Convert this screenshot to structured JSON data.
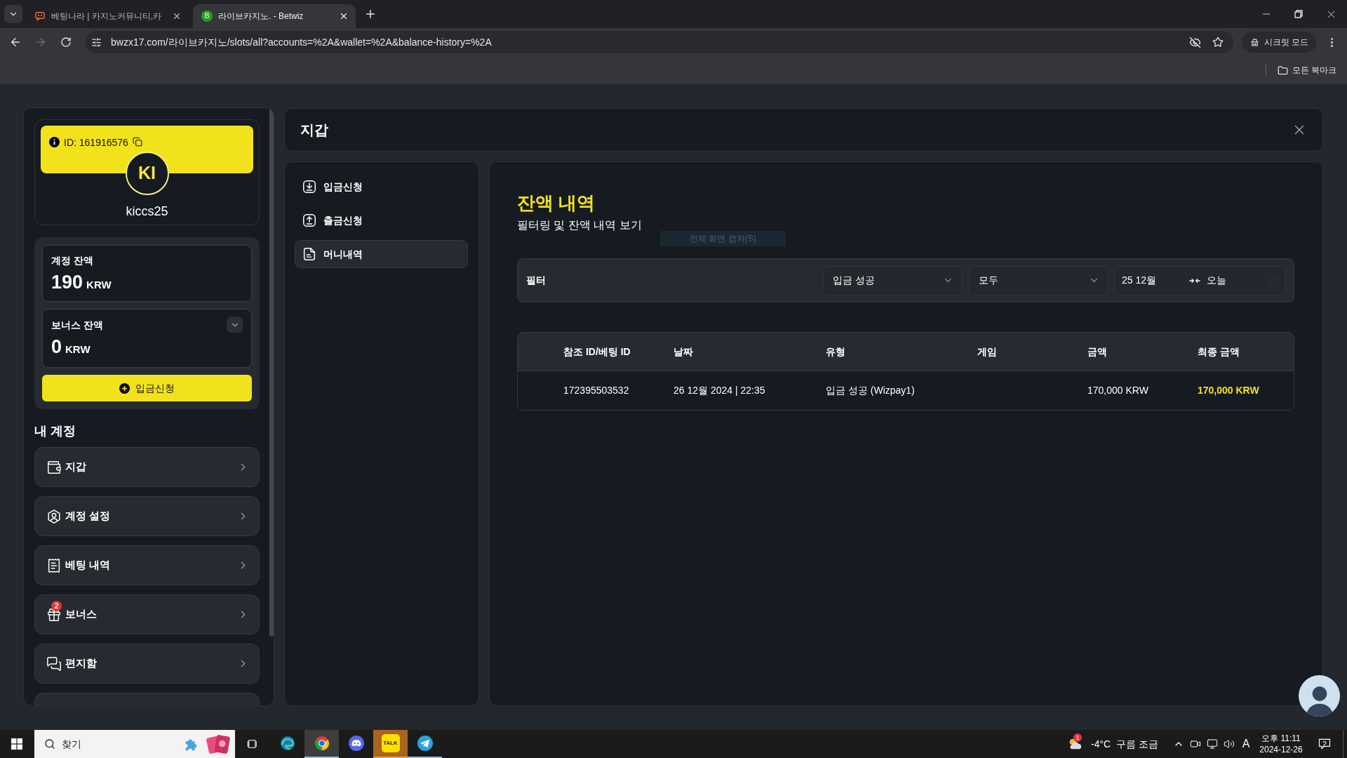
{
  "browser": {
    "tabs": [
      {
        "title": "베팅나라 | 카지노커뮤니티,카",
        "selected": false
      },
      {
        "title": "라이브카지노. - Betwiz",
        "selected": true,
        "favicon_letter": "B"
      }
    ],
    "back_enabled": true,
    "forward_enabled": false,
    "url": "bwzx17.com/라이브카지노/slots/all?accounts=%2A&wallet=%2A&balance-history=%2A",
    "starred": false,
    "incognito_label": "시크릿 모드",
    "bookmarks_label": "모든 북마크"
  },
  "sidebar": {
    "user_id": "ID: 161916576",
    "avatar_initials": "KI",
    "username": "kiccs25",
    "balances": [
      {
        "label": "계정 잔액",
        "amount": "190",
        "currency": "KRW",
        "expandable": false
      },
      {
        "label": "보너스 잔액",
        "amount": "0",
        "currency": "KRW",
        "expandable": true
      }
    ],
    "deposit_button": "입금신청",
    "section_title": "내 계정",
    "menu": [
      {
        "label": "지갑"
      },
      {
        "label": "계정 설정"
      },
      {
        "label": "베팅 내역"
      },
      {
        "label": "보너스",
        "badge": "2"
      },
      {
        "label": "편지함"
      }
    ],
    "more_items_below": true
  },
  "wallet": {
    "title": "지갑",
    "nav": [
      {
        "label": "입금신청",
        "selected": false
      },
      {
        "label": "출금신청",
        "selected": false
      },
      {
        "label": "머니내역",
        "selected": true
      }
    ],
    "heading": "잔액 내역",
    "subheading": "필터링 및 잔액 내역 보기",
    "filter": {
      "label": "필터",
      "selects": [
        "입금 성공",
        "모두"
      ],
      "date_from": "25 12월",
      "date_to": "오늘"
    },
    "table": {
      "columns": [
        "참조 ID/베팅 ID",
        "날짜",
        "유형",
        "게임",
        "금액",
        "최종 금액"
      ],
      "rows": [
        [
          "172395503532",
          "26 12월 2024 | 22:35",
          "입금 성공 (Wizpay1)",
          null,
          "170,000 KRW",
          "170,000 KRW"
        ]
      ]
    }
  },
  "capture_tooltip": "전체 화면 캡처(S)",
  "taskbar": {
    "search_placeholder": "찾기",
    "apps": [
      {
        "open": false,
        "focused": false,
        "attention": false
      },
      {
        "open": true,
        "focused": true,
        "attention": false
      },
      {
        "open": false,
        "focused": false,
        "attention": false
      },
      {
        "open": true,
        "focused": false,
        "attention": true,
        "label": "TALK"
      },
      {
        "open": true,
        "focused": false,
        "attention": false
      }
    ],
    "weather": {
      "temperature": "-4°C",
      "condition": "구름 조금",
      "badge": "1"
    },
    "input_mode": "A",
    "time": "오후 11:11",
    "date": "2024-12-26",
    "notifications": "2"
  }
}
